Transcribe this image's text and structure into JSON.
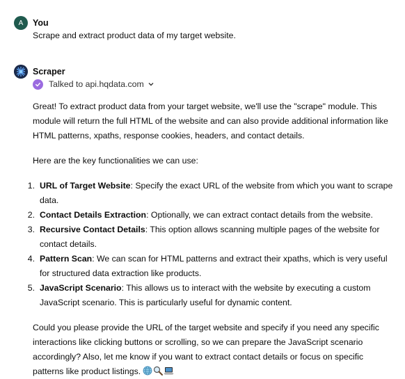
{
  "user_message": {
    "avatar_initial": "A",
    "sender": "You",
    "text": "Scrape and extract product data of my target website."
  },
  "bot_message": {
    "sender": "Scraper",
    "tool_call": "Talked to api.hqdata.com",
    "intro": "Great! To extract product data from your target website, we'll use the \"scrape\" module. This module will return the full HTML of the website and can also provide additional information like HTML patterns, xpaths, response cookies, headers, and contact details.",
    "list_intro": "Here are the key functionalities we can use:",
    "items": [
      {
        "num": "1.",
        "title": "URL of Target Website",
        "desc": ": Specify the exact URL of the website from which you want to scrape data."
      },
      {
        "num": "2.",
        "title": "Contact Details Extraction",
        "desc": ": Optionally, we can extract contact details from the website."
      },
      {
        "num": "3.",
        "title": "Recursive Contact Details",
        "desc": ": This option allows scanning multiple pages of the website for contact details."
      },
      {
        "num": "4.",
        "title": "Pattern Scan",
        "desc": ": We can scan for HTML patterns and extract their xpaths, which is very useful for structured data extraction like products."
      },
      {
        "num": "5.",
        "title": "JavaScript Scenario",
        "desc": ": This allows us to interact with the website by executing a custom JavaScript scenario. This is particularly useful for dynamic content."
      }
    ],
    "closing": "Could you please provide the URL of the target website and specify if you need any specific interactions like clicking buttons or scrolling, so we can prepare the JavaScript scenario accordingly? Also, let me know if you want to extract contact details or focus on specific patterns like product listings.",
    "closing_emojis": [
      "globe-icon",
      "magnifier-icon",
      "laptop-icon"
    ]
  },
  "colors": {
    "user_avatar": "#1f5a4e",
    "bot_avatar": "#1b2a4a",
    "tool_check": "#9b6be0"
  }
}
